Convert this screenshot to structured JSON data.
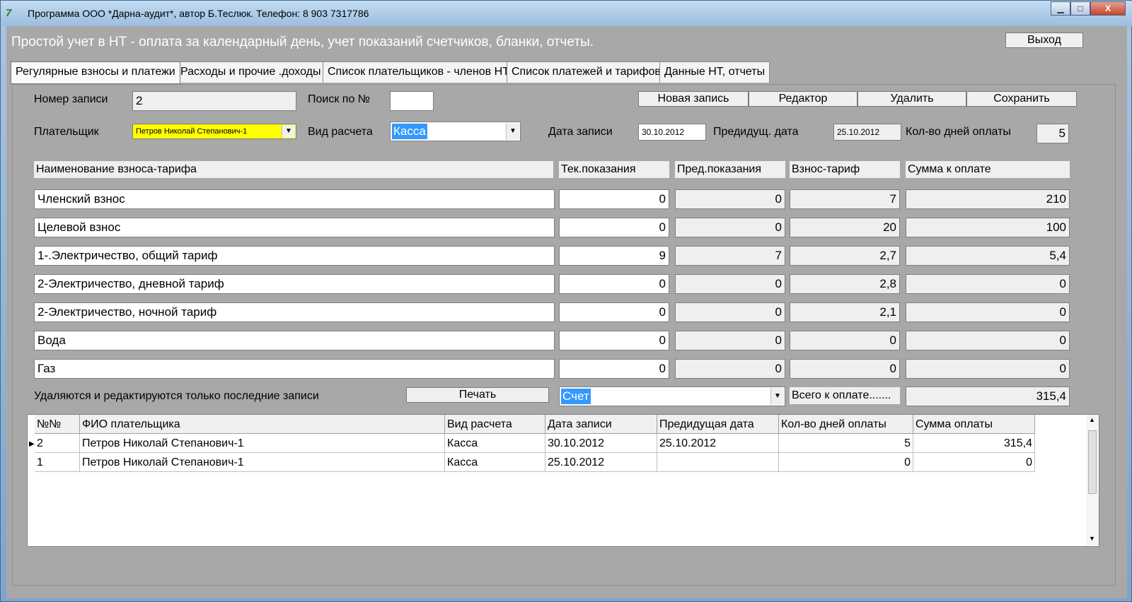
{
  "window": {
    "title": "Программа ООО *Дарна-аудит*, автор Б.Теслюк. Телефон: 8 903 7317786",
    "icon": "7",
    "controls": {
      "minimize": "▁",
      "maximize": "□",
      "close": "X"
    }
  },
  "header": {
    "title": "Простой учет в НТ - оплата за календарный день, учет показаний счетчиков, бланки, отчеты.",
    "exit_label": "Выход"
  },
  "tabs": [
    {
      "label": "Регулярные взносы и платежи"
    },
    {
      "label": "Расходы и прочие .доходы"
    },
    {
      "label": "Список плательщиков - членов НТ"
    },
    {
      "label": "Список платежей и тарифов"
    },
    {
      "label": "Данные НТ, отчеты"
    }
  ],
  "form": {
    "record_no_label": "Номер записи",
    "record_no_value": "2",
    "search_label": "Поиск по №",
    "search_value": "",
    "payer_label": "Плательщик",
    "payer_value": "Петров Николай Степанович-1",
    "calc_type_label": "Вид расчета",
    "calc_type_value": "Касса",
    "record_date_label": "Дата записи",
    "record_date_value": "30.10.2012",
    "prev_date_label": "Предидущ. дата",
    "prev_date_value": "25.10.2012",
    "days_label": "Кол-во дней оплаты",
    "days_value": "5",
    "buttons": {
      "new": "Новая запись",
      "edit": "Редактор",
      "delete": "Удалить",
      "save": "Сохранить"
    }
  },
  "tariff_headers": {
    "name": "Наименование взноса-тарифа",
    "current": "Тек.показания",
    "previous": "Пред.показания",
    "tariff": "Взнос-тариф",
    "sum": "Сумма к оплате"
  },
  "tariff_rows": [
    {
      "name": "Членский взнос",
      "current": "0",
      "previous": "0",
      "tariff": "7",
      "sum": "210"
    },
    {
      "name": "Целевой взнос",
      "current": "0",
      "previous": "0",
      "tariff": "20",
      "sum": "100"
    },
    {
      "name": "1-.Электричество, общий тариф",
      "current": "9",
      "previous": "7",
      "tariff": "2,7",
      "sum": "5,4"
    },
    {
      "name": "2-Электричество, дневной тариф",
      "current": "0",
      "previous": "0",
      "tariff": "2,8",
      "sum": "0"
    },
    {
      "name": "2-Электричество, ночной тариф",
      "current": "0",
      "previous": "0",
      "tariff": "2,1",
      "sum": "0"
    },
    {
      "name": "Вода",
      "current": "0",
      "previous": "0",
      "tariff": "0",
      "sum": "0"
    },
    {
      "name": "Газ",
      "current": "0",
      "previous": "0",
      "tariff": "0",
      "sum": "0"
    }
  ],
  "footer": {
    "note": "Удаляются и редактируются только последние записи",
    "print_label": "Печать",
    "doc_type_value": "Счет",
    "total_label": "Всего к оплате.......",
    "total_value": "315,4"
  },
  "grid": {
    "columns": [
      "№№",
      "ФИО плательщика",
      "Вид расчета",
      "Дата записи",
      "Предидущая дата",
      "Кол-во дней оплаты",
      "Сумма оплаты"
    ],
    "rows": [
      [
        "2",
        "Петров Николай Степанович-1",
        "Касса",
        "30.10.2012",
        "25.10.2012",
        "5",
        "315,4"
      ],
      [
        "1",
        "Петров Николай Степанович-1",
        "Касса",
        "25.10.2012",
        "",
        "0",
        "0"
      ]
    ]
  },
  "colors": {
    "payer_highlight": "#ffff00",
    "selection": "#3399ff",
    "panel_bg": "#a8a8a8"
  }
}
